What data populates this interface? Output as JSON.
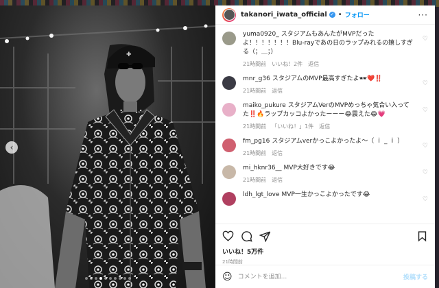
{
  "header": {
    "username": "takanori_iwata_official",
    "verified_icon": "verified-badge-icon",
    "separator": "•",
    "follow_label": "フォロー",
    "more_label": "···"
  },
  "comments": [
    {
      "user": "yuma0920_",
      "text": "スタジアムもあんたがMVPだったよ！！！！！！！Blu-rayであの日のラップみれるの嬉しすぎる（；＿；）",
      "time": "21時間前",
      "likes": "いいね！2件",
      "reply": "返信",
      "avatar_color": "#9a9a8a"
    },
    {
      "user": "mnr_g36",
      "text": "スタジアムのMVP最高すぎたよ🕶❤️‼️",
      "time": "21時間前",
      "likes": "",
      "reply": "返信",
      "avatar_color": "#3a3a44"
    },
    {
      "user": "maiko_pukure",
      "text": "スタジアムVerのMVPめっちゃ気合い入ってた‼️🔥ラップカッコよかったーーー😂震えた😂💗",
      "time": "21時間前",
      "likes": "「いいね！」1件",
      "reply": "返信",
      "avatar_color": "#e8b0c8"
    },
    {
      "user": "fm_pg16",
      "text": "スタジアムverかっこよかったよ〜（ ｉ _ ｉ ）",
      "time": "21時間前",
      "likes": "",
      "reply": "返信",
      "avatar_color": "#d06070"
    },
    {
      "user": "mi_hknr36__",
      "text": "MVP大好きです😂",
      "time": "21時間前",
      "likes": "",
      "reply": "返信",
      "avatar_color": "#c8b8a8"
    },
    {
      "user": "ldh_lgt_love",
      "text": "MVP一生かっこよかったです😂",
      "time": "",
      "likes": "",
      "reply": "",
      "avatar_color": "#b04060"
    }
  ],
  "actions": {
    "like_icon": "heart-icon",
    "comment_icon": "comment-icon",
    "share_icon": "share-icon",
    "save_icon": "bookmark-icon",
    "likes_count": "いいね！5万件",
    "time": "21時間前"
  },
  "add_comment": {
    "emoji_icon": "smile-icon",
    "placeholder": "コメントを追加...",
    "post_label": "投稿する"
  },
  "carousel": {
    "prev_label": "‹",
    "dot_count": 10,
    "active_dot": 3
  },
  "colors": {
    "accent": "#0095f6",
    "text": "#262626",
    "muted": "#8e8e8e",
    "post_disabled": "#b2dffc"
  }
}
